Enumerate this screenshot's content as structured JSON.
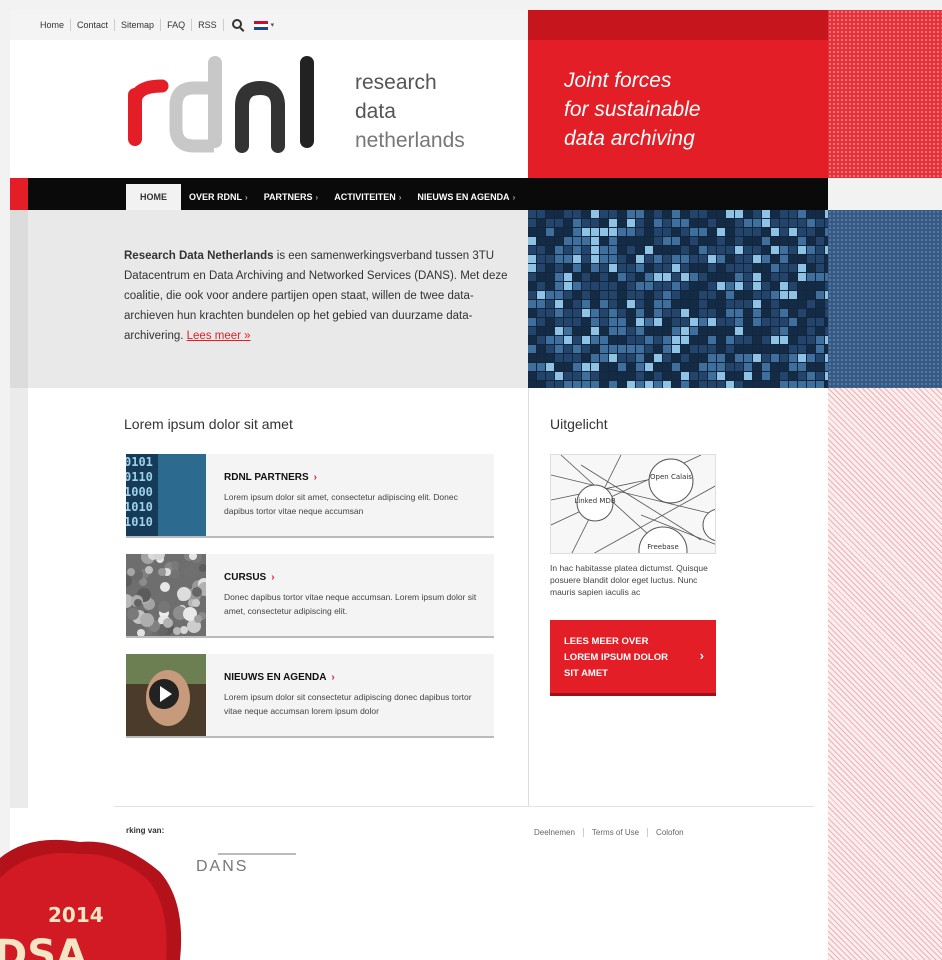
{
  "utility_nav": {
    "links": [
      "Home",
      "Contact",
      "Sitemap",
      "FAQ",
      "RSS"
    ]
  },
  "logo": {
    "letters": "rdnl",
    "lines": [
      "research",
      "data",
      "netherlands"
    ]
  },
  "tagline": [
    "Joint forces",
    "for sustainable",
    "data archiving"
  ],
  "main_nav": {
    "active": "HOME",
    "items": [
      "OVER RDNL",
      "PARTNERS",
      "ACTIVITEITEN",
      "NIEUWS EN AGENDA"
    ]
  },
  "intro": {
    "bold": "Research Data Netherlands",
    "text": " is een samenwerkingsverband tussen 3TU Datacentrum en Data Archiving and Networked Services (DANS). Met deze coalitie, die ook voor andere partijen open staat, willen de twee data-archieven hun krachten bundelen op het gebied van duurzame data-archivering. ",
    "link": "Lees meer »"
  },
  "main": {
    "title": "Lorem ipsum dolor sit amet",
    "cards": [
      {
        "title": "RDNL PARTNERS",
        "body": "Lorem ipsum dolor sit amet, consectetur adipiscing elit. Donec dapibus tortor vitae neque accumsan"
      },
      {
        "title": "CURSUS",
        "body": "Donec dapibus tortor vitae neque accumsan. Lorem ipsum dolor sit amet, consectetur adipiscing elit."
      },
      {
        "title": "NIEUWS EN AGENDA",
        "body": "Lorem ipsum dolor sit consectetur adipiscing donec dapibus tortor vitae neque accumsan lorem ipsum dolor"
      }
    ]
  },
  "sidebar": {
    "title": "Uitgelicht",
    "diagram_labels": [
      "Open Calais",
      "Linked MDB",
      "Freebase"
    ],
    "text": "In hac habitasse platea dictumst. Quisque posuere blandit dolor eget luctus. Nunc mauris sapien iaculis ac",
    "cta": "LEES MEER OVER LOREM IPSUM DOLOR SIT AMET"
  },
  "footer": {
    "cooperation": "rking van:",
    "partner": "DANS",
    "links": [
      "Deelnemen",
      "Terms of Use",
      "Colofon"
    ]
  },
  "seal": {
    "year": "2014",
    "text": "DSA"
  },
  "colors": {
    "brand_red": "#e31e26",
    "nav_black": "#0a0a0a",
    "deco_blue": "#355a86"
  }
}
